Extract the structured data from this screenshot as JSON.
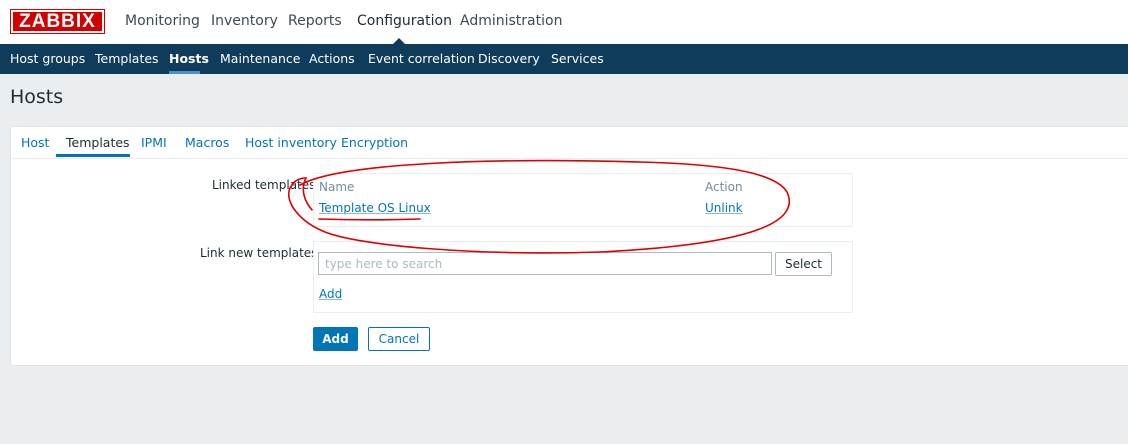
{
  "logo": {
    "text": "ZABBIX"
  },
  "top_nav": {
    "items": [
      "Monitoring",
      "Inventory",
      "Reports",
      "Configuration",
      "Administration"
    ],
    "active": "Configuration"
  },
  "sub_nav": {
    "items": [
      "Host groups",
      "Templates",
      "Hosts",
      "Maintenance",
      "Actions",
      "Event correlation",
      "Discovery",
      "Services"
    ],
    "active": "Hosts"
  },
  "page": {
    "title": "Hosts"
  },
  "tabs": {
    "items": [
      "Host",
      "Templates",
      "IPMI",
      "Macros",
      "Host inventory",
      "Encryption"
    ],
    "active": "Templates"
  },
  "form": {
    "linked_templates_label": "Linked templates",
    "table": {
      "headers": [
        "Name",
        "Action"
      ],
      "rows": [
        {
          "name": "Template OS Linux",
          "action": "Unlink"
        }
      ]
    },
    "link_new_label": "Link new templates",
    "search_placeholder": "type here to search",
    "select_label": "Select",
    "add_link_label": "Add",
    "submit_label": "Add",
    "cancel_label": "Cancel"
  },
  "annotation": {
    "color": "#e00000"
  }
}
